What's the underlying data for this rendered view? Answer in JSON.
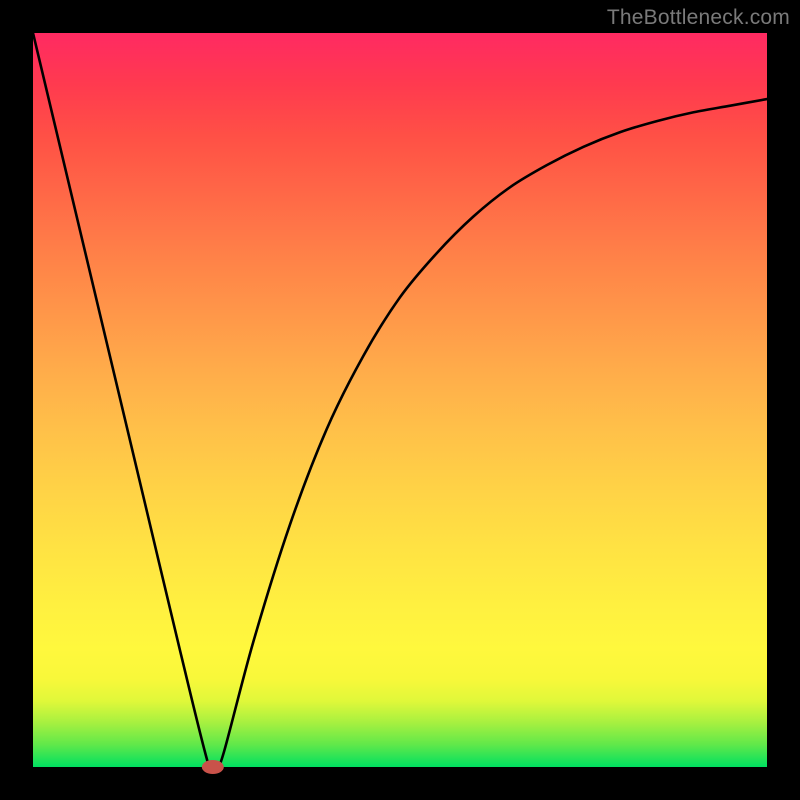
{
  "attribution": "TheBottleneck.com",
  "chart_data": {
    "type": "line",
    "title": "",
    "xlabel": "",
    "ylabel": "",
    "xlim": [
      0,
      100
    ],
    "ylim": [
      0,
      100
    ],
    "grid": false,
    "legend": false,
    "series": [
      {
        "name": "curve",
        "x": [
          0,
          5,
          10,
          15,
          20,
          24,
          25,
          26,
          30,
          35,
          40,
          45,
          50,
          55,
          60,
          65,
          70,
          75,
          80,
          85,
          90,
          95,
          100
        ],
        "y": [
          100,
          79,
          58,
          37,
          16,
          0,
          0,
          2,
          17,
          33,
          46,
          56,
          64,
          70,
          75,
          79,
          82,
          84.5,
          86.5,
          88,
          89.2,
          90.1,
          91
        ]
      }
    ],
    "marker": {
      "name": "min-point",
      "x": 24.5,
      "y": 0,
      "color": "#C9524A"
    },
    "gradient_stops": [
      {
        "pos": 0,
        "color": "#00E060"
      },
      {
        "pos": 50,
        "color": "#FFC049"
      },
      {
        "pos": 100,
        "color": "#FF2A62"
      }
    ]
  }
}
